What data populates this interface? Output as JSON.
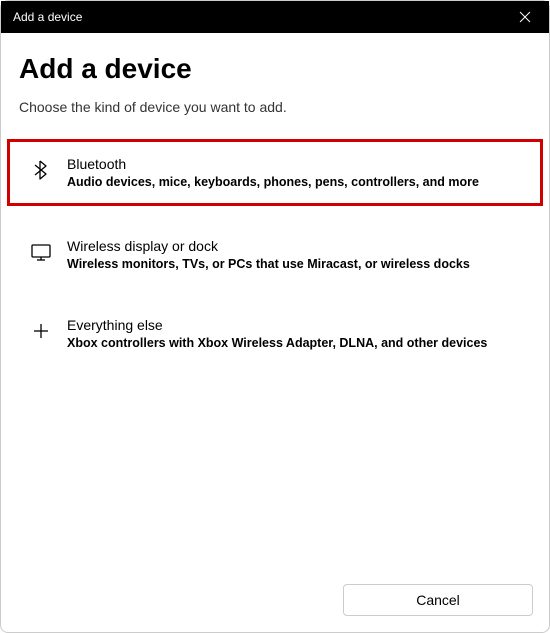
{
  "titlebar": {
    "title": "Add a device"
  },
  "content": {
    "heading": "Add a device",
    "subheading": "Choose the kind of device you want to add."
  },
  "options": [
    {
      "title": "Bluetooth",
      "desc": "Audio devices, mice, keyboards, phones, pens, controllers, and more",
      "highlighted": true
    },
    {
      "title": "Wireless display or dock",
      "desc": "Wireless monitors, TVs, or PCs that use Miracast, or wireless docks",
      "highlighted": false
    },
    {
      "title": "Everything else",
      "desc": "Xbox controllers with Xbox Wireless Adapter, DLNA, and other devices",
      "highlighted": false
    }
  ],
  "footer": {
    "cancel_label": "Cancel"
  }
}
